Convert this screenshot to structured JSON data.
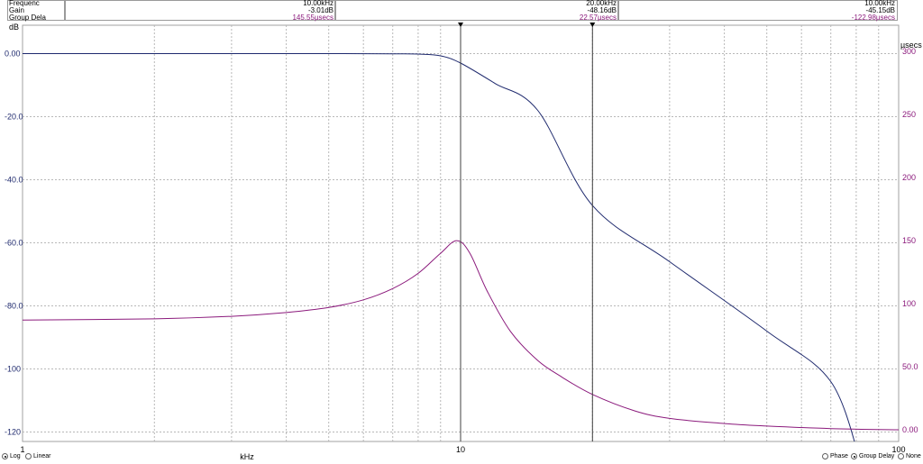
{
  "readout": {
    "rows": [
      {
        "label": "Frequenc",
        "c1": "10.00kHz",
        "c2": "20.00kHz",
        "c3": "10.00kHz",
        "color": "#000000"
      },
      {
        "label": "Gain",
        "c1": "-3.01dB",
        "c2": "-48.16dB",
        "c3": "-45.15dB",
        "color": "#000000"
      },
      {
        "label": "Group Dela",
        "c1": "145.55µsecs",
        "c2": "22.57µsecs",
        "c3": "-122.98µsecs",
        "color": "#8b1a7c"
      }
    ]
  },
  "axes": {
    "left_unit": "dB",
    "right_unit": "µsecs",
    "x_unit": "kHz"
  },
  "colors": {
    "gain": "#1f2a6e",
    "delay": "#8b1a7c",
    "grid": "#b8b8b8",
    "cursor": "#404040",
    "axis_text_left": "#1f2a6e",
    "axis_text_right": "#8b1a7c"
  },
  "chart_data": {
    "type": "line",
    "x_scale": "log",
    "xlim": [
      1,
      100
    ],
    "x_ticks": [
      {
        "value": 1,
        "label": "1"
      },
      {
        "value": 10,
        "label": "10"
      },
      {
        "value": 100,
        "label": "100"
      }
    ],
    "y_left": {
      "lim": [
        -123,
        9
      ],
      "ticks": [
        {
          "value": 0,
          "label": "0.00"
        },
        {
          "value": -20,
          "label": "-20.0"
        },
        {
          "value": -40,
          "label": "-40.0"
        },
        {
          "value": -60,
          "label": "-60.0"
        },
        {
          "value": -80,
          "label": "-80.0"
        },
        {
          "value": -100,
          "label": "-100"
        },
        {
          "value": -120,
          "label": "-120"
        }
      ]
    },
    "y_right": {
      "lim": [
        -9.25,
        320.75
      ],
      "ticks": [
        {
          "value": 300,
          "label": "300"
        },
        {
          "value": 250,
          "label": "250"
        },
        {
          "value": 200,
          "label": "200"
        },
        {
          "value": 150,
          "label": "150"
        },
        {
          "value": 100,
          "label": "100"
        },
        {
          "value": 50,
          "label": "50.0"
        },
        {
          "value": 0,
          "label": "0.00"
        }
      ]
    },
    "cursors": [
      10,
      20
    ],
    "series": [
      {
        "axis": "left",
        "x": [
          1,
          2,
          3,
          5,
          7,
          8,
          9,
          10,
          12,
          15,
          20,
          30,
          50,
          70,
          82
        ],
        "values": [
          0,
          0,
          0,
          0,
          -0.05,
          -0.15,
          -0.7,
          -3.01,
          -9.5,
          -18,
          -48.16,
          -66,
          -88,
          -104,
          -130
        ]
      },
      {
        "axis": "right",
        "x": [
          1,
          2,
          3,
          4,
          5,
          6,
          7,
          8,
          9,
          9.8,
          10.5,
          11.5,
          13,
          15,
          17,
          20,
          25,
          30,
          40,
          50,
          70,
          100
        ],
        "values": [
          87,
          88,
          90,
          93,
          97,
          103,
          112,
          124,
          140,
          150,
          140,
          110,
          78,
          55,
          42,
          28,
          15,
          9,
          5,
          3,
          1,
          0
        ]
      }
    ]
  },
  "bottom": {
    "left_radios": [
      {
        "label": "Log",
        "checked": true
      },
      {
        "label": "Linear",
        "checked": false
      }
    ],
    "right_radios": [
      {
        "label": "Phase",
        "checked": false
      },
      {
        "label": "Group Delay",
        "checked": true
      },
      {
        "label": "None",
        "checked": false
      }
    ]
  }
}
